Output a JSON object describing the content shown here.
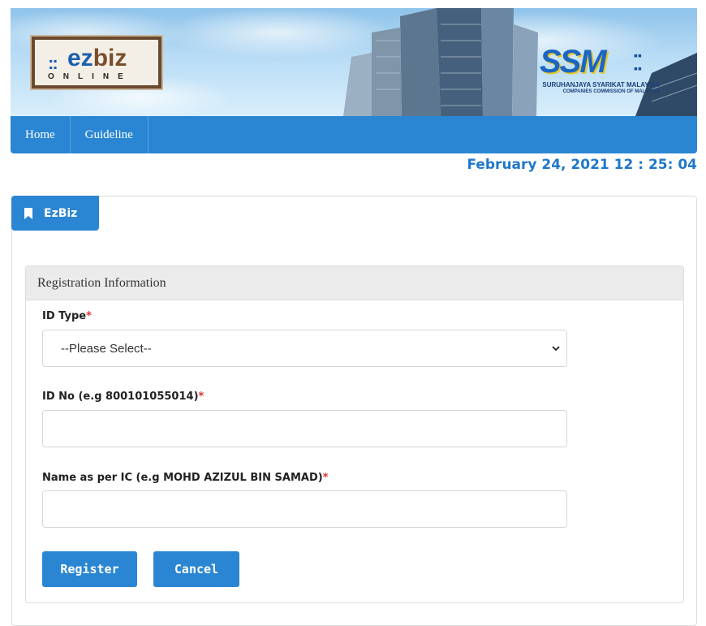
{
  "header": {
    "logo_left": {
      "name": "ezbiz-logo",
      "ez": "ez",
      "biz": "biz",
      "sub": "ONLINE"
    },
    "logo_right": {
      "name": "ssm-logo",
      "mark": "SSM",
      "line1": "SURUHANJAYA SYARIKAT MALAYSIA",
      "line2": "COMPANIES COMMISSION OF MALAYSIA"
    }
  },
  "nav": {
    "items": [
      {
        "label": "Home"
      },
      {
        "label": "Guideline"
      }
    ]
  },
  "clock": "February 24, 2021 12 : 25: 04",
  "card": {
    "tab_label": "EzBiz",
    "tab_icon": "bookmark-icon"
  },
  "panel": {
    "title": "Registration Information",
    "fields": {
      "id_type": {
        "label": "ID Type",
        "required": "*",
        "selected": "--Please Select--"
      },
      "id_no": {
        "label": "ID No (e.g 800101055014)",
        "required": "*",
        "value": "",
        "placeholder": ""
      },
      "name": {
        "label": "Name as per IC (e.g MOHD AZIZUL BIN SAMAD)",
        "required": "*",
        "value": "",
        "placeholder": ""
      }
    },
    "buttons": {
      "register": "Register",
      "cancel": "Cancel"
    }
  },
  "colors": {
    "primary": "#2a86d2",
    "clock": "#1f78c9",
    "required": "#e0322f"
  }
}
